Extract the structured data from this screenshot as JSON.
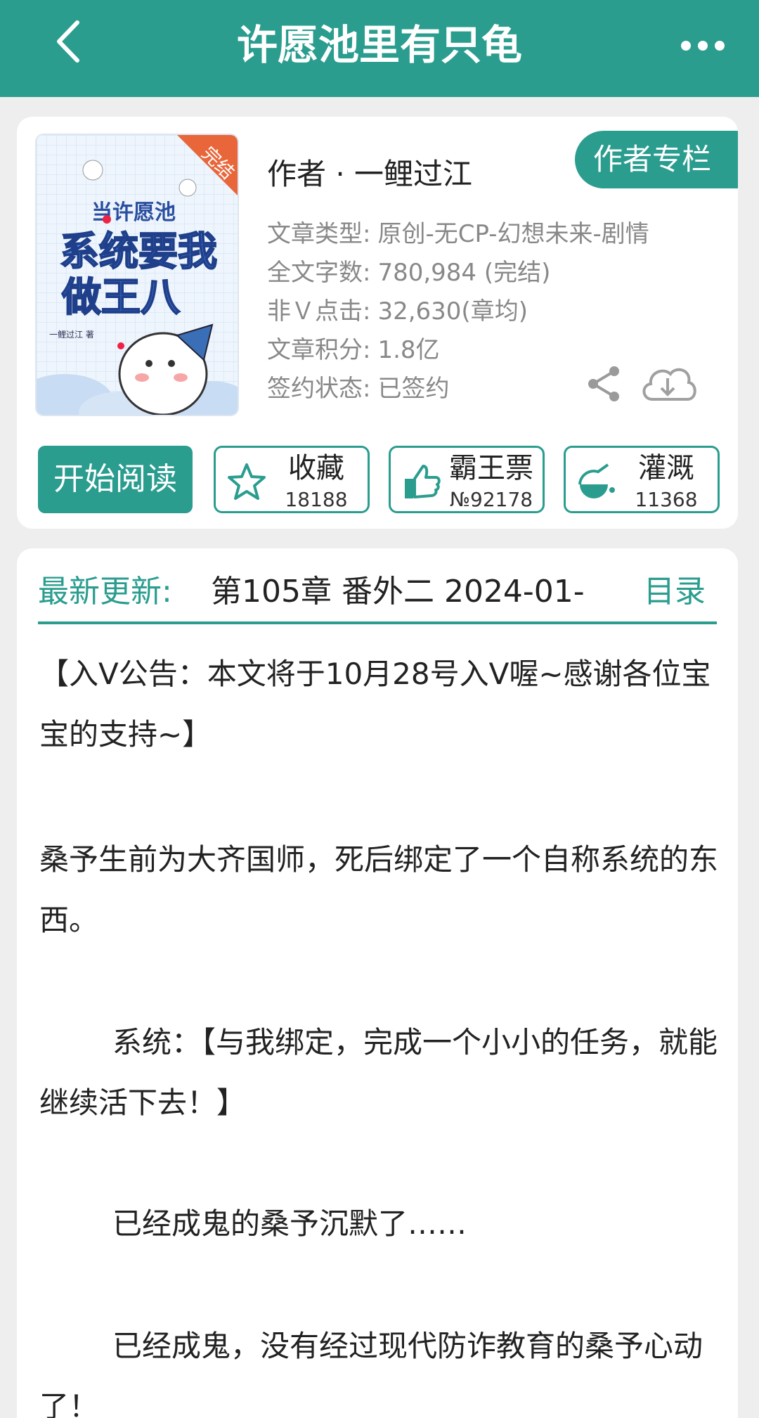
{
  "header": {
    "title": "许愿池里有只龟"
  },
  "book": {
    "cover_texts": {
      "badge": "完结",
      "line1": "当许愿池",
      "line2": "系统要我",
      "line3": "做王八",
      "author_tag": "一鲤过江 著"
    },
    "author_line": "作者 · 一鲤过江",
    "author_column_label": "作者专栏",
    "meta": [
      {
        "label": "文章类型:",
        "value": "原创-无CP-幻想未来-剧情"
      },
      {
        "label": "全文字数:",
        "value": "780,984 (完结)"
      },
      {
        "label": "非Ｖ点击:",
        "value": "32,630(章均)"
      },
      {
        "label": "文章积分:",
        "value": "1.8亿"
      },
      {
        "label": "签约状态:",
        "value": "已签约"
      }
    ]
  },
  "actions": {
    "read_label": "开始阅读",
    "collect": {
      "label": "收藏",
      "count": "18188"
    },
    "ticket": {
      "label": "霸王票",
      "count": "№92178"
    },
    "water": {
      "label": "灌溉",
      "count": "11368"
    }
  },
  "update": {
    "label": "最新更新:",
    "text": "第105章  番外二  2024-01-",
    "toc_label": "目录"
  },
  "content": {
    "p1": "【入V公告：本文将于10月28号入V喔~感谢各位宝宝的支持~】",
    "p2": "桑予生前为大齐国师，死后绑定了一个自称系统的东西。",
    "p3": "系统：【与我绑定，完成一个小小的任务，就能继续活下去！】",
    "p4": "已经成鬼的桑予沉默了……",
    "p5": "已经成鬼，没有经过现代防诈教育的桑予心动了！"
  },
  "colors": {
    "accent": "#2a9d8f",
    "background": "#eeeeee"
  }
}
